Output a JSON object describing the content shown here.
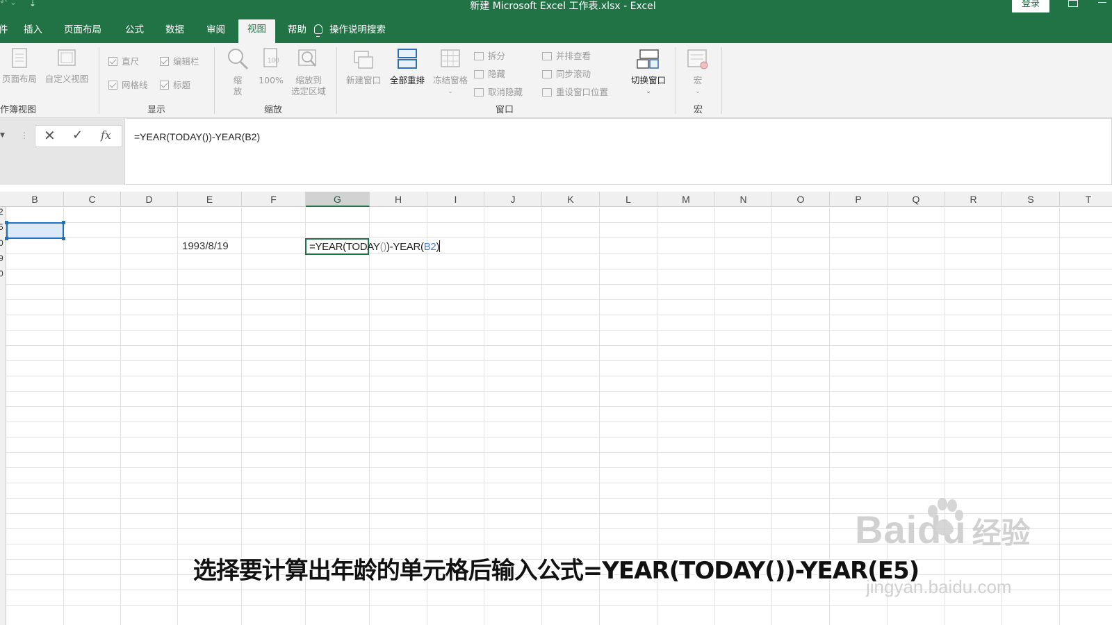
{
  "title_bar": {
    "document_title": "新建 Microsoft Excel 工作表.xlsx  -  Excel",
    "login_label": "登录",
    "qat_customize_glyph": "⇣",
    "colors": {
      "brand": "#217346"
    }
  },
  "tabs": [
    {
      "label": "插入",
      "active": false
    },
    {
      "label": "页面布局",
      "active": false
    },
    {
      "label": "公式",
      "active": false
    },
    {
      "label": "数据",
      "active": false
    },
    {
      "label": "审阅",
      "active": false
    },
    {
      "label": "视图",
      "active": true
    },
    {
      "label": "帮助",
      "active": false
    }
  ],
  "tell_me": {
    "label": "操作说明搜索",
    "icon": "lightbulb-icon"
  },
  "ribbon": {
    "workbook_views": {
      "group_label": "作簿视图",
      "page_layout": "页面布局",
      "custom_views": "自定义视图"
    },
    "show": {
      "group_label": "显示",
      "ruler": "直尺",
      "formula_bar": "编辑栏",
      "gridlines": "网格线",
      "headings": "标题"
    },
    "zoom": {
      "group_label": "缩放",
      "zoom_line1": "缩",
      "zoom_line2": "放",
      "zoom_100": "100%",
      "zoom_selection_line1": "缩放到",
      "zoom_selection_line2": "选定区域"
    },
    "window": {
      "group_label": "窗口",
      "new_window": "新建窗口",
      "arrange_all": "全部重排",
      "freeze_panes": "冻结窗格",
      "split": "拆分",
      "hide": "隐藏",
      "unhide": "取消隐藏",
      "view_side_by_side": "并排查看",
      "sync_scroll": "同步滚动",
      "reset_position": "重设窗口位置",
      "switch_windows": "切换窗口"
    },
    "macros": {
      "group_label": "宏",
      "macros": "宏"
    }
  },
  "formula_bar": {
    "cancel_glyph": "✕",
    "enter_glyph": "✓",
    "fx_label": "fx",
    "value": "=YEAR(TODAY())-YEAR(B2)"
  },
  "grid": {
    "columns": [
      "B",
      "C",
      "D",
      "E",
      "F",
      "G",
      "H",
      "I",
      "J",
      "K",
      "L",
      "M",
      "N",
      "O",
      "P",
      "Q",
      "R",
      "S",
      "T"
    ],
    "selected_column": "G",
    "row_number_fragments": [
      "2",
      "5",
      "0",
      "9",
      "0"
    ],
    "cells": {
      "E4": "1993/8/19",
      "G4_formula_prefix": "=YEAR(TODAY",
      "G4_formula_parens": "()",
      "G4_formula_mid": ")-YEAR(",
      "G4_formula_ref": "B2",
      "G4_formula_suffix": ")"
    }
  },
  "subtitle": "选择要计算出年龄的单元格后输入公式=YEAR(TODAY())-YEAR(E5)",
  "watermark": {
    "brand": "Baidu",
    "cn": "经验",
    "url": "jingyan.baidu.com"
  }
}
